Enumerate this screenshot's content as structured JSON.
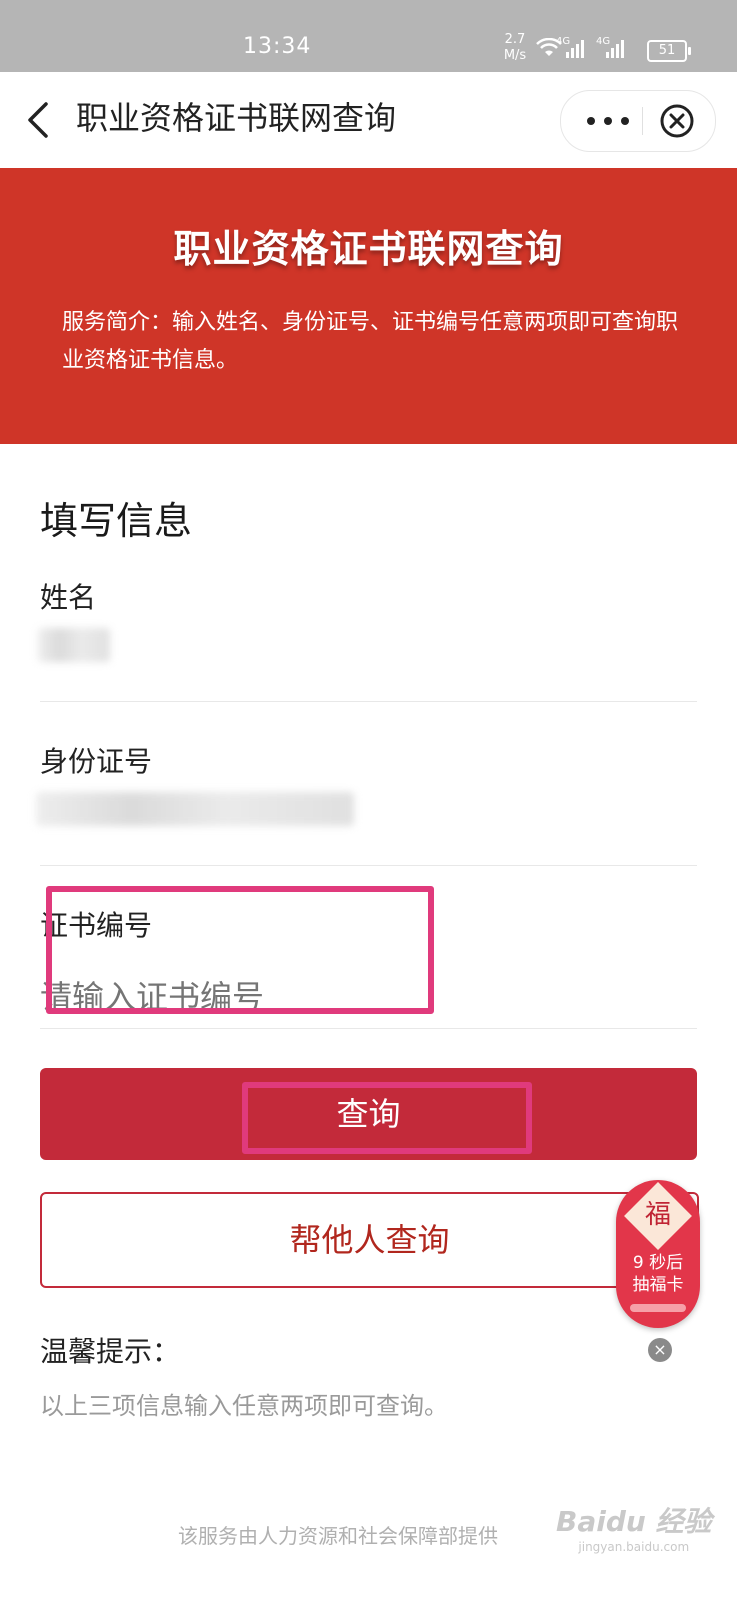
{
  "status_bar": {
    "time": "13:34",
    "network_speed": "2.7 M/s",
    "sim1": "4G",
    "sim2": "4G",
    "battery": "51"
  },
  "nav": {
    "title": "职业资格证书联网查询"
  },
  "banner": {
    "title": "职业资格证书联网查询",
    "description": "服务简介：输入姓名、身份证号、证书编号任意两项即可查询职业资格证书信息。"
  },
  "form": {
    "section_title": "填写信息",
    "name_label": "姓名",
    "id_label": "身份证号",
    "cert_label": "证书编号",
    "cert_placeholder": "请输入证书编号",
    "query_button": "查询",
    "help_button": "帮他人查询"
  },
  "tip": {
    "title": "温馨提示：",
    "text": "以上三项信息输入任意两项即可查询。"
  },
  "promo": {
    "char": "福",
    "countdown": "9 秒后",
    "action": "抽福卡"
  },
  "footer": {
    "text": "该服务由人力资源和社会保障部提供"
  },
  "watermark": {
    "brand": "Baidu 经验",
    "sub": "jingyan.baidu.com"
  },
  "colors": {
    "banner": "#cf3528",
    "primary_button": "#c32a3a",
    "highlight": "#e03a7c"
  }
}
